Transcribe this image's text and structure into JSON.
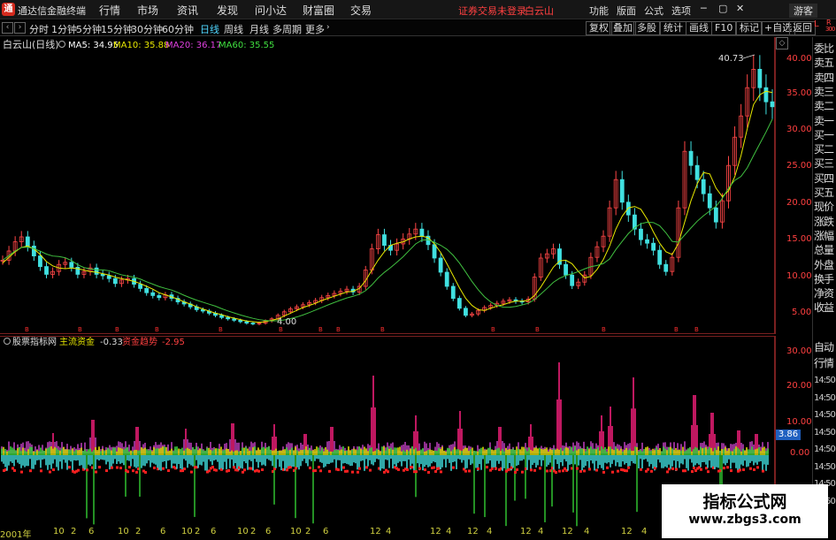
{
  "window": {
    "logo_glyph": "通",
    "title": "通达信金融终端"
  },
  "menu": {
    "items": [
      "行情",
      "市场",
      "资讯",
      "发现",
      "问小达",
      "财富圈",
      "交易"
    ]
  },
  "notice": "证券交易未登录",
  "stock_name_top": "白云山",
  "right_menu": [
    "功能",
    "版面",
    "公式",
    "选项"
  ],
  "window_controls": {
    "minimize": "─",
    "restore": "▢",
    "close": "✕"
  },
  "user_btn": "游客",
  "periods": [
    "分时",
    "1分钟",
    "5分钟",
    "15分钟",
    "30分钟",
    "60分钟",
    "日线",
    "周线",
    "月线",
    "多周期",
    "更多"
  ],
  "active_period": "日线",
  "toolbar": [
    "复权",
    "叠加",
    "多股",
    "统计",
    "画线",
    "F10",
    "标记",
    "+自选",
    "返回"
  ],
  "main_chart": {
    "title": "白云山(日线)",
    "ma": [
      {
        "label": "MA5: 34.95",
        "color": "#ffffff"
      },
      {
        "label": "MA10: 35.88",
        "color": "#e8e800"
      },
      {
        "label": "MA20: 36.17",
        "color": "#e040e0"
      },
      {
        "label": "MA60: 35.55",
        "color": "#40e040"
      }
    ],
    "y_ticks": [
      "40.00",
      "35.00",
      "30.00",
      "25.00",
      "20.00",
      "15.00",
      "10.00",
      "5.00"
    ],
    "high_label": "40.73",
    "low_label": "4.00"
  },
  "indicator": {
    "title": "股票指标网",
    "label1": "主流资金",
    "value1": "-0.33",
    "label2": "资金趋势",
    "value2": "-2.95",
    "y_ticks": [
      "30.00",
      "20.00",
      "10.00",
      "0.00"
    ],
    "current_value": "3.86"
  },
  "sidebar": {
    "top_labels": [
      "L",
      "R",
      "300"
    ],
    "items": [
      "委比",
      "卖五",
      "卖四",
      "卖三",
      "卖二",
      "卖一",
      "买一",
      "买二",
      "买三",
      "买四",
      "买五",
      "现价",
      "涨跌",
      "涨幅",
      "总量",
      "外盘",
      "换手",
      "净资",
      "收益",
      "自动",
      "行情",
      "14:50",
      "14:50",
      "14:50",
      "14:50",
      "14:50",
      "14:50",
      "14:50",
      "14:50"
    ]
  },
  "xaxis": [
    "2001年",
    "10",
    "2",
    "6",
    "10",
    "2",
    "6",
    "10",
    "2",
    "6",
    "10",
    "2",
    "6",
    "10",
    "2",
    "6",
    "12",
    "4",
    "12",
    "4",
    "12",
    "4",
    "12",
    "4",
    "12",
    "4",
    "12",
    "4"
  ],
  "watermark": {
    "line1": "指标公式网",
    "line2": "www.zbgs3.com"
  },
  "chart_data": {
    "type": "candlestick",
    "ylim": [
      3,
      42
    ],
    "close": [
      13.2,
      14.5,
      15.8,
      16.5,
      15.2,
      13.8,
      12.3,
      11.2,
      11.6,
      12.6,
      12.9,
      12.2,
      11.2,
      11.6,
      12.1,
      11.2,
      11.0,
      10.6,
      9.9,
      10.4,
      10.6,
      9.8,
      9.2,
      8.6,
      8.2,
      7.9,
      8.3,
      7.8,
      7.3,
      7.0,
      6.6,
      6.2,
      6.0,
      5.7,
      5.4,
      5.1,
      4.9,
      4.7,
      4.5,
      4.3,
      4.2,
      4.3,
      4.6,
      4.9,
      5.4,
      5.9,
      6.3,
      6.6,
      6.9,
      7.2,
      7.5,
      7.9,
      8.2,
      8.5,
      8.8,
      9.1,
      8.7,
      9.5,
      11.8,
      14.8,
      16.8,
      15.3,
      14.6,
      15.5,
      16.2,
      16.9,
      17.6,
      16.6,
      15.4,
      13.5,
      11.5,
      9.5,
      7.8,
      6.4,
      5.4,
      5.6,
      6.1,
      6.5,
      6.8,
      7.1,
      7.4,
      7.6,
      7.4,
      7.3,
      7.7,
      10.8,
      13.5,
      14.1,
      14.8,
      12.6,
      11.1,
      9.6,
      10.1,
      11.1,
      13.6,
      15.1,
      16.6,
      20.6,
      24.6,
      21.4,
      19.6,
      17.6,
      16.1,
      15.6,
      14.6,
      12.6,
      11.6,
      13.6,
      20.6,
      28.6,
      26.6,
      24.6,
      22.6,
      20.6,
      18.6,
      21.6,
      26.6,
      30.6,
      33.6,
      37.6,
      40.2,
      37.6,
      35.6,
      34.9
    ],
    "ma5": [
      12.8,
      13.6,
      14.4,
      15.0,
      15.2,
      14.8,
      14.0,
      13.0,
      12.4,
      12.1,
      12.0,
      12.1,
      12.0,
      11.8,
      11.6,
      11.5,
      11.3,
      11.1,
      10.8,
      10.6,
      10.4,
      10.2,
      9.9,
      9.5,
      9.1,
      8.6,
      8.3,
      8.0,
      7.7,
      7.3,
      7.0,
      6.6,
      6.3,
      6.0,
      5.7,
      5.5,
      5.2,
      5.0,
      4.8,
      4.6,
      4.5,
      4.4,
      4.5,
      4.7,
      4.9,
      5.3,
      5.7,
      6.1,
      6.5,
      6.8,
      7.1,
      7.5,
      7.8,
      8.1,
      8.4,
      8.7,
      8.8,
      9.2,
      10.3,
      11.8,
      13.2,
      14.4,
      15.3,
      15.6,
      15.8,
      16.2,
      16.5,
      16.6,
      16.4,
      15.5,
      14.3,
      12.7,
      11.0,
      9.3,
      7.8,
      6.8,
      6.2,
      6.1,
      6.4,
      6.7,
      6.9,
      7.2,
      7.4,
      7.4,
      7.5,
      8.2,
      9.4,
      10.8,
      12.2,
      13.1,
      13.2,
      12.7,
      11.6,
      10.7,
      10.9,
      11.9,
      13.3,
      15.2,
      17.6,
      19.4,
      20.6,
      20.8,
      20.4,
      19.0,
      17.2,
      15.6,
      14.4,
      14.0,
      15.6,
      18.6,
      21.6,
      24.0,
      25.6,
      25.4,
      23.4,
      22.2,
      23.0,
      25.0,
      28.0,
      31.8,
      35.2,
      36.6,
      37.1,
      36.9
    ]
  }
}
